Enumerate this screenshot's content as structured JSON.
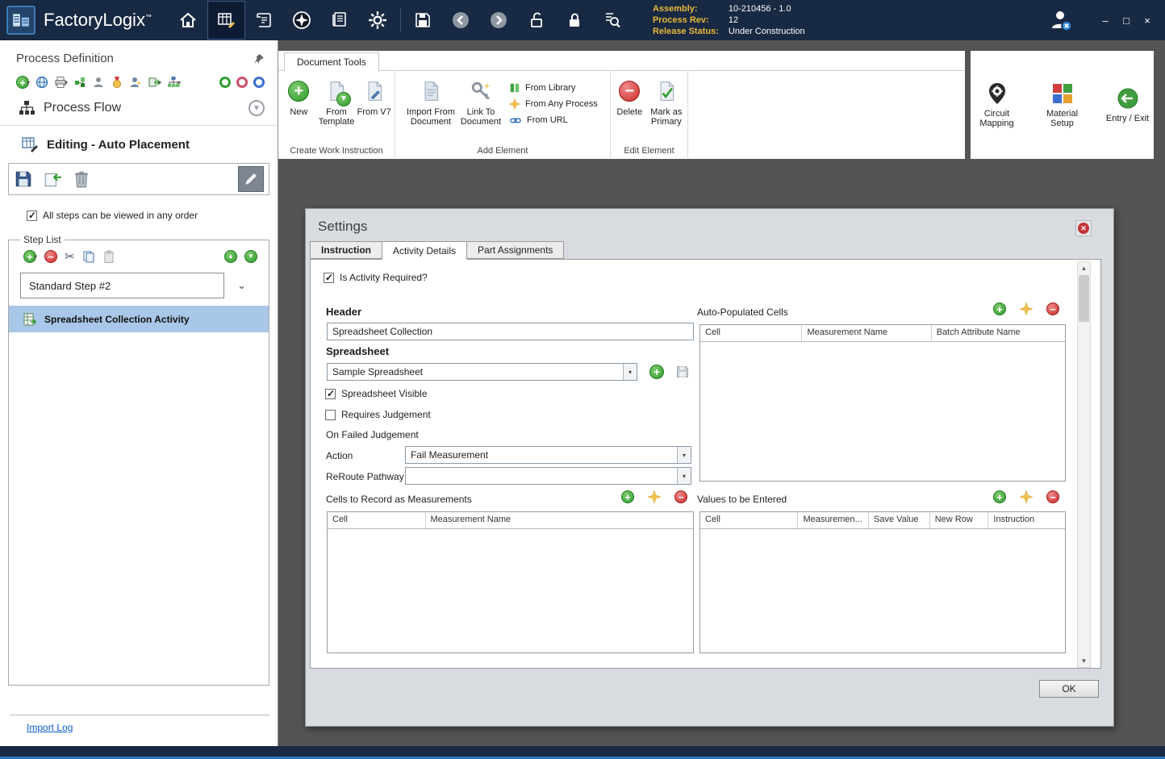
{
  "titlebar": {
    "app_name": "FactoryLogix",
    "trademark": "™",
    "info": {
      "assembly_label": "Assembly:",
      "assembly_value": "10-210456 - 1.0",
      "process_rev_label": "Process Rev:",
      "process_rev_value": "12",
      "release_status_label": "Release Status:",
      "release_status_value": "Under Construction"
    },
    "window": {
      "minimize": "–",
      "maximize": "□",
      "close": "×"
    }
  },
  "sidebar": {
    "title": "Process Definition",
    "process_flow_label": "Process Flow",
    "editing_label": "Editing - Auto Placement",
    "view_order_checkbox": "All steps can be viewed in any order",
    "step_list": {
      "title": "Step List",
      "step_selector_value": "Standard Step #2",
      "selected_activity": "Spreadsheet Collection Activity"
    },
    "import_log_link": "Import Log"
  },
  "ribbon": {
    "tab_label": "Document Tools",
    "groups": [
      {
        "label": "Create Work Instruction",
        "items": [
          {
            "label": "New"
          },
          {
            "label": "From Template"
          },
          {
            "label": "From V7"
          }
        ]
      },
      {
        "label": "Add Element",
        "items": [
          {
            "label": "Import From Document"
          },
          {
            "label": "Link To Document"
          }
        ],
        "stack_items": [
          {
            "label": "From Library"
          },
          {
            "label": "From Any Process"
          },
          {
            "label": "From URL"
          }
        ]
      },
      {
        "label": "Edit Element",
        "items": [
          {
            "label": "Delete"
          },
          {
            "label": "Mark as Primary"
          }
        ]
      }
    ],
    "right_items": [
      {
        "label": "Circuit Mapping"
      },
      {
        "label": "Material Setup"
      },
      {
        "label": "Entry / Exit"
      }
    ]
  },
  "settings": {
    "title": "Settings",
    "tabs": [
      {
        "label": "Instruction"
      },
      {
        "label": "Activity Details"
      },
      {
        "label": "Part Assignments"
      }
    ],
    "active_tab": "Activity Details",
    "fields": {
      "is_activity_required": "Is Activity Required?",
      "header_label": "Header",
      "header_value": "Spreadsheet Collection",
      "spreadsheet_label": "Spreadsheet",
      "spreadsheet_value": "Sample Spreadsheet",
      "spreadsheet_visible": "Spreadsheet Visible",
      "requires_judgement": "Requires Judgement",
      "on_failed_judgement": "On Failed Judgement",
      "action_label": "Action",
      "action_value": "Fail Measurement",
      "reroute_label": "ReRoute Pathway",
      "reroute_value": ""
    },
    "auto_populated_cells": {
      "title": "Auto-Populated Cells",
      "columns": [
        "Cell",
        "Measurement Name",
        "Batch Attribute Name"
      ],
      "rows": []
    },
    "cells_to_record": {
      "title": "Cells to Record as Measurements",
      "columns": [
        "Cell",
        "Measurement Name"
      ],
      "rows": []
    },
    "values_to_enter": {
      "title": "Values to be Entered",
      "columns": [
        "Cell",
        "Measuremen...",
        "Save Value",
        "New Row",
        "Instruction"
      ],
      "rows": []
    },
    "ok_button": "OK"
  },
  "icons": {
    "caret_down": "▾",
    "chevron_down": "⌄",
    "scissors": "✂",
    "plus": "+",
    "minus": "−",
    "up_arrow": "▲",
    "down_arrow": "▼",
    "close_x": "✕"
  },
  "colors": {
    "titlebar": "#182943",
    "selection": "#a9c7e8",
    "accent_green": "#2f9e2f",
    "accent_red": "#cc2a2a",
    "gold_label": "#e9b838",
    "link": "#0b5bd3",
    "workspace": "#545454"
  }
}
